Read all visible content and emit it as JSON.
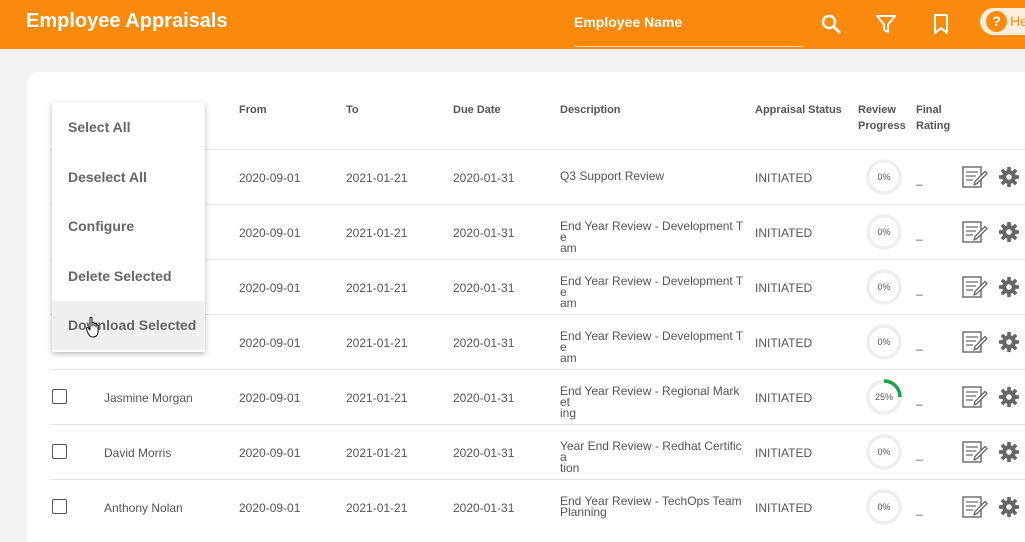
{
  "header": {
    "title": "Employee Appraisals",
    "search_placeholder": "Employee Name",
    "icons": [
      "search-icon",
      "filter-icon",
      "bookmark-icon"
    ],
    "help": {
      "icon": "question-icon",
      "label": "He"
    }
  },
  "columns": {
    "from": "From",
    "to": "To",
    "due_date": "Due Date",
    "description": "Description",
    "status": "Appraisal Status",
    "progress": [
      "Review",
      "Progress"
    ],
    "rating": [
      "Final",
      "Rating"
    ]
  },
  "rows": [
    {
      "name": "",
      "from": "2020-09-01",
      "to": "2021-01-21",
      "due": "2020-01-31",
      "description": [
        "Q3 Support Review"
      ],
      "status": "INITIATED",
      "progress": 0,
      "progress_label": "0%",
      "rating": "_"
    },
    {
      "name": "",
      "from": "2020-09-01",
      "to": "2021-01-21",
      "due": "2020-01-31",
      "description": [
        "End Year Review - Development Te",
        "am"
      ],
      "status": "INITIATED",
      "progress": 0,
      "progress_label": "0%",
      "rating": "_"
    },
    {
      "name": "",
      "from": "2020-09-01",
      "to": "2021-01-21",
      "due": "2020-01-31",
      "description": [
        "End Year Review - Development Te",
        "am"
      ],
      "status": "INITIATED",
      "progress": 0,
      "progress_label": "0%",
      "rating": "_"
    },
    {
      "name": "",
      "from": "2020-09-01",
      "to": "2021-01-21",
      "due": "2020-01-31",
      "description": [
        "End Year Review - Development Te",
        "am"
      ],
      "status": "INITIATED",
      "progress": 0,
      "progress_label": "0%",
      "rating": "_"
    },
    {
      "name": "Jasmine Morgan",
      "from": "2020-09-01",
      "to": "2021-01-21",
      "due": "2020-01-31",
      "description": [
        "End Year Review - Regional Market",
        "ing"
      ],
      "status": "INITIATED",
      "progress": 25,
      "progress_label": "25%",
      "rating": "_"
    },
    {
      "name": "David Morris",
      "from": "2020-09-01",
      "to": "2021-01-21",
      "due": "2020-01-31",
      "description": [
        "Year End Review - Redhat Certifica",
        "tion"
      ],
      "status": "INITIATED",
      "progress": 0,
      "progress_label": "0%",
      "rating": "_"
    },
    {
      "name": "Anthony Nolan",
      "from": "2020-09-01",
      "to": "2021-01-21",
      "due": "2020-01-31",
      "description": [
        "End Year Review - TechOps Team",
        "Planning"
      ],
      "status": "INITIATED",
      "progress": 0,
      "progress_label": "0%",
      "rating": "_"
    }
  ],
  "row_icons": {
    "edit": "edit-document-icon",
    "settings": "gear-icon"
  },
  "context_menu": {
    "items": [
      "Select All",
      "Deselect All",
      "Configure",
      "Delete Selected",
      "Download Selected"
    ],
    "hovered": "Download Selected"
  },
  "colors": {
    "brand": "#f98a0e",
    "progress": "#1aa34a",
    "track": "#eeeeee"
  }
}
